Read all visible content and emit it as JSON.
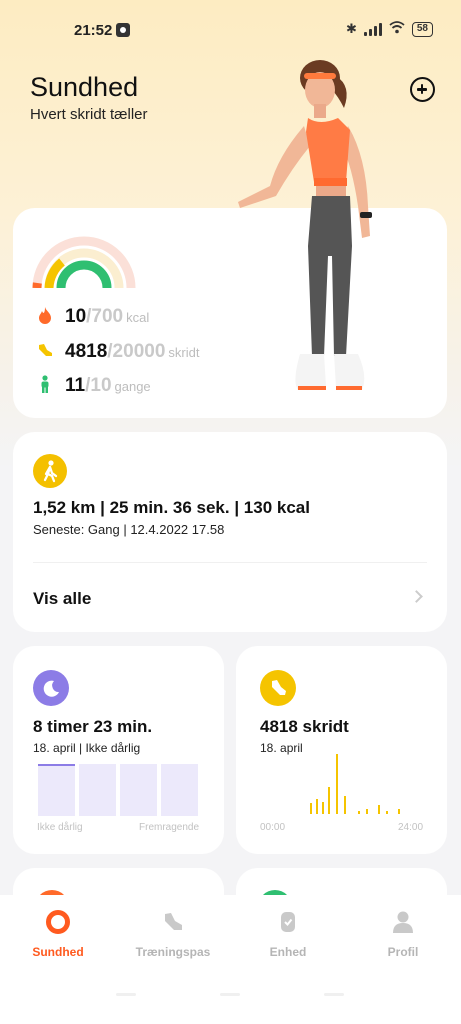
{
  "status_bar": {
    "time": "21:52",
    "battery": "58"
  },
  "header": {
    "title": "Sundhed",
    "subtitle": "Hvert skridt tæller"
  },
  "activity": {
    "calories": {
      "value": "10",
      "goal": "/700",
      "unit": "kcal",
      "icon": "flame-icon",
      "color": "#ff6a2a"
    },
    "steps": {
      "value": "4818",
      "goal": "/20000",
      "unit": "skridt",
      "icon": "shoe-icon",
      "color": "#f5c400"
    },
    "stand": {
      "value": "11",
      "goal": "/10",
      "unit": "gange",
      "icon": "person-icon",
      "color": "#2fbf71"
    }
  },
  "workout": {
    "icon": "walking-icon",
    "summary": "1,52 km | 25 min. 36 sek. | 130 kcal",
    "last": "Seneste: Gang | 12.4.2022 17.58",
    "see_all": "Vis alle"
  },
  "sleep": {
    "icon": "moon-icon",
    "color": "#8c7ce6",
    "title": "8 timer 23 min.",
    "date": "18. april | Ikke dårlig",
    "axis_left": "Ikke dårlig",
    "axis_right": "Fremragende"
  },
  "steps_card": {
    "icon": "shoe-icon",
    "color": "#f5c400",
    "title": "4818 skridt",
    "date": "18. april",
    "axis_start": "00:00",
    "axis_end": "24:00",
    "hourly_relative": [
      0.18,
      0.25,
      0.2,
      0.45,
      1.0,
      0.3,
      0.05,
      0.08,
      0.15,
      0.05,
      0.08
    ]
  },
  "tabs": [
    {
      "label": "Sundhed",
      "icon": "health-ring-icon",
      "active": true
    },
    {
      "label": "Træningspas",
      "icon": "shoe-icon",
      "active": false
    },
    {
      "label": "Enhed",
      "icon": "watch-icon",
      "active": false
    },
    {
      "label": "Profil",
      "icon": "profile-icon",
      "active": false
    }
  ]
}
